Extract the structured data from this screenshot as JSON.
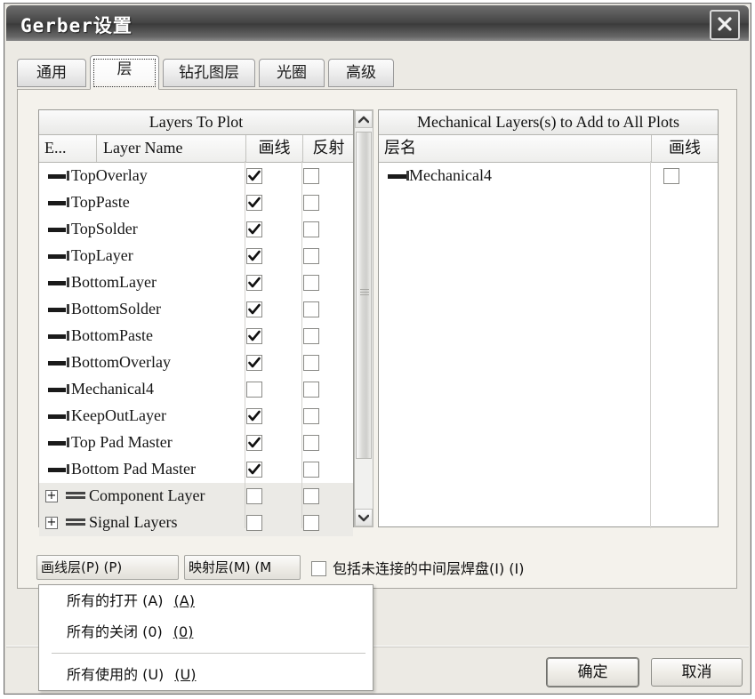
{
  "window": {
    "title": "Gerber设置",
    "close_icon": "close-icon"
  },
  "tabs": [
    {
      "label": "通用",
      "active": false
    },
    {
      "label": "层",
      "active": true
    },
    {
      "label": "钻孔图层",
      "active": false
    },
    {
      "label": "光圈",
      "active": false
    },
    {
      "label": "高级",
      "active": false
    }
  ],
  "left_panel": {
    "title": "Layers To Plot",
    "columns": [
      "E...",
      "Layer Name",
      "画线",
      "反射"
    ],
    "rows": [
      {
        "name": "TopOverlay",
        "plot": true,
        "mirror": false,
        "type": "layer"
      },
      {
        "name": "TopPaste",
        "plot": true,
        "mirror": false,
        "type": "layer"
      },
      {
        "name": "TopSolder",
        "plot": true,
        "mirror": false,
        "type": "layer"
      },
      {
        "name": "TopLayer",
        "plot": true,
        "mirror": false,
        "type": "layer"
      },
      {
        "name": "BottomLayer",
        "plot": true,
        "mirror": false,
        "type": "layer"
      },
      {
        "name": "BottomSolder",
        "plot": true,
        "mirror": false,
        "type": "layer"
      },
      {
        "name": "BottomPaste",
        "plot": true,
        "mirror": false,
        "type": "layer"
      },
      {
        "name": "BottomOverlay",
        "plot": true,
        "mirror": false,
        "type": "layer"
      },
      {
        "name": "Mechanical4",
        "plot": false,
        "mirror": false,
        "type": "layer"
      },
      {
        "name": "KeepOutLayer",
        "plot": true,
        "mirror": false,
        "type": "layer"
      },
      {
        "name": "Top Pad Master",
        "plot": true,
        "mirror": false,
        "type": "layer"
      },
      {
        "name": "Bottom Pad Master",
        "plot": true,
        "mirror": false,
        "type": "layer"
      },
      {
        "name": "Component Layer",
        "plot": false,
        "mirror": false,
        "type": "group",
        "expander": "+"
      },
      {
        "name": "Signal Layers",
        "plot": false,
        "mirror": false,
        "type": "group",
        "expander": "+"
      }
    ]
  },
  "right_panel": {
    "title": "Mechanical Layers(s) to Add to All Plots",
    "columns": [
      "层名",
      "画线"
    ],
    "rows": [
      {
        "name": "Mechanical4",
        "plot": false
      }
    ]
  },
  "bottom_controls": {
    "plot_layers_button": "画线层(P) (P)",
    "mirror_layers_button": "映射层(M) (M",
    "include_checkbox_label": "包括未连接的中间层焊盘(I) (I)",
    "include_checkbox_checked": false
  },
  "dropdown_menu": {
    "open": true,
    "items": [
      {
        "label": "所有的打开 (A)",
        "accelerator": "(A)"
      },
      {
        "label": "所有的关闭 (0)",
        "accelerator": "(0)"
      },
      {
        "separator": true
      },
      {
        "label": "所有使用的 (U)",
        "accelerator": "(U)"
      }
    ]
  },
  "footer": {
    "ok": "确定",
    "cancel": "取消"
  }
}
